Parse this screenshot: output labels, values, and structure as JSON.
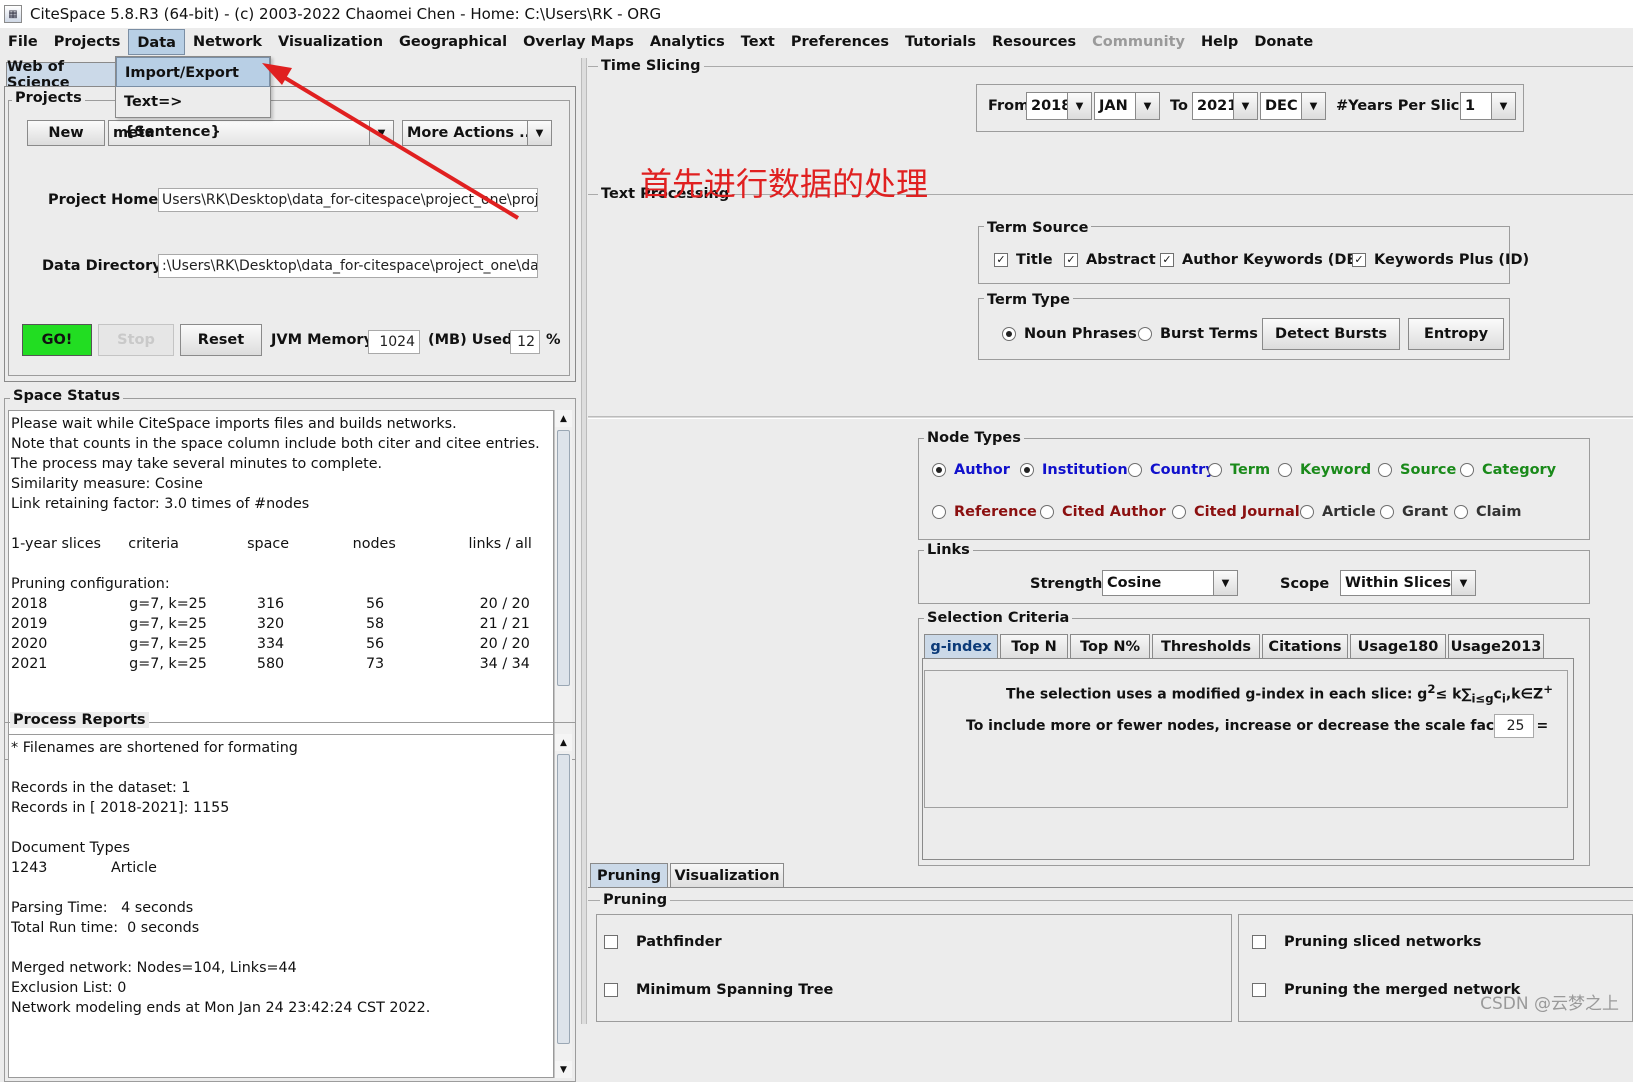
{
  "window": {
    "title": "CiteSpace 5.8.R3 (64-bit) - (c) 2003-2022 Chaomei Chen - Home: C:\\Users\\RK - ORG",
    "icon": "citespace-app-icon"
  },
  "menubar": [
    "File",
    "Projects",
    "Data",
    "Network",
    "Visualization",
    "Geographical",
    "Overlay Maps",
    "Analytics",
    "Text",
    "Preferences",
    "Tutorials",
    "Resources",
    "Community",
    "Help",
    "Donate"
  ],
  "menubar_active": "Data",
  "menubar_disabled": "Community",
  "data_menu": {
    "items": [
      "Import/Export",
      "Text=>{Sentence}"
    ],
    "highlighted": "Import/Export"
  },
  "annotation": {
    "text": "首先进行数据的处理",
    "color": "#e02020"
  },
  "left": {
    "tab": "Web of Science",
    "projects": {
      "legend": "Projects",
      "new_label": "New",
      "project_value": "meta",
      "more_actions": "More Actions ...",
      "home_label": "Project Home:",
      "home_value": "Users\\RK\\Desktop\\data_for-citespace\\project_one\\project",
      "data_label": "Data Directory:",
      "data_value": ":\\Users\\RK\\Desktop\\data_for-citespace\\project_one\\data"
    },
    "controls": {
      "go": "GO!",
      "stop": "Stop",
      "reset": "Reset",
      "jvm_label": "JVM Memory",
      "jvm_value": "1024",
      "mb_used": "(MB) Used",
      "used_value": "12",
      "percent": "%",
      "go_color": "#22dd22"
    },
    "space_status": {
      "legend": "Space Status",
      "text": "Please wait while CiteSpace imports files and builds networks.\nNote that counts in the space column include both citer and citee entries.\nThe process may take several minutes to complete.\nSimilarity measure: Cosine\nLink retaining factor: 3.0 times of #nodes\n\n1-year slices      criteria               space              nodes                links / all\n\nPruning configuration:\n2018                  g=7, k=25           316                  56                     20 / 20\n2019                  g=7, k=25           320                  58                     21 / 21\n2020                  g=7, k=25           334                  56                     20 / 20\n2021                  g=7, k=25           580                  73                     34 / 34"
    },
    "process_reports": {
      "legend": "Process Reports",
      "text": "* Filenames are shortened for formating\n\nRecords in the dataset: 1\nRecords in [ 2018-2021]: 1155\n\nDocument Types\n1243              Article\n\nParsing Time:   4 seconds\nTotal Run time:  0 seconds\n\nMerged network: Nodes=104, Links=44\nExclusion List: 0\nNetwork modeling ends at Mon Jan 24 23:42:24 CST 2022."
    }
  },
  "right": {
    "time_slicing": {
      "legend": "Time Slicing",
      "from_label": "From",
      "from_year": "2018",
      "from_month": "JAN",
      "to_label": "To",
      "to_year": "2021",
      "to_month": "DEC",
      "years_label": "#Years Per Slice",
      "years_value": "1"
    },
    "text_processing": {
      "legend": "Text Processing",
      "term_source": {
        "legend": "Term Source",
        "items": [
          {
            "label": "Title",
            "checked": true
          },
          {
            "label": "Abstract",
            "checked": true
          },
          {
            "label": "Author Keywords (DE)",
            "checked": true
          },
          {
            "label": "Keywords Plus (ID)",
            "checked": true
          }
        ]
      },
      "term_type": {
        "legend": "Term Type",
        "noun": "Noun Phrases",
        "burst": "Burst Terms",
        "selected": "Noun Phrases",
        "detect": "Detect Bursts",
        "entropy": "Entropy"
      }
    },
    "node_types": {
      "legend": "Node Types",
      "row1": [
        {
          "label": "Author",
          "color": "#1010cc",
          "on": true
        },
        {
          "label": "Institution",
          "color": "#1010cc",
          "on": true
        },
        {
          "label": "Country",
          "color": "#1010cc",
          "on": false
        },
        {
          "label": "Term",
          "color": "#1a8a1a",
          "on": false
        },
        {
          "label": "Keyword",
          "color": "#1a8a1a",
          "on": false
        },
        {
          "label": "Source",
          "color": "#1a8a1a",
          "on": false
        },
        {
          "label": "Category",
          "color": "#1a8a1a",
          "on": false
        }
      ],
      "row2": [
        {
          "label": "Reference",
          "color": "#8b1010",
          "on": false
        },
        {
          "label": "Cited Author",
          "color": "#8b1010",
          "on": false
        },
        {
          "label": "Cited Journal",
          "color": "#8b1010",
          "on": false
        },
        {
          "label": "Article",
          "color": "#333333",
          "on": false
        },
        {
          "label": "Grant",
          "color": "#333333",
          "on": false
        },
        {
          "label": "Claim",
          "color": "#333333",
          "on": false
        }
      ]
    },
    "links": {
      "legend": "Links",
      "strength_label": "Strength",
      "strength_value": "Cosine",
      "scope_label": "Scope",
      "scope_value": "Within Slices"
    },
    "selection": {
      "legend": "Selection Criteria",
      "tabs": [
        "g-index",
        "Top N",
        "Top N%",
        "Thresholds",
        "Citations",
        "Usage180",
        "Usage2013"
      ],
      "selected": "g-index",
      "line1": "The selection uses a modified g-index in each slice: g",
      "sup_2": "2",
      "line1_mid": "≤ k∑",
      "sub": "i≤g",
      "line1_c": "c",
      "sub_i": "i",
      "line1_end": ",k∈Z",
      "sup_plus": "+",
      "line2": "To include more or fewer nodes, increase or decrease the scale factor k =",
      "k_value": "25"
    },
    "bottom_tabs": [
      "Pruning",
      "Visualization"
    ],
    "bottom_selected": "Pruning",
    "pruning": {
      "legend": "Pruning",
      "left": [
        "Pathfinder",
        "Minimum Spanning Tree"
      ],
      "right": [
        "Pruning sliced networks",
        "Pruning the merged network"
      ]
    }
  },
  "watermark": "CSDN @云梦之上"
}
